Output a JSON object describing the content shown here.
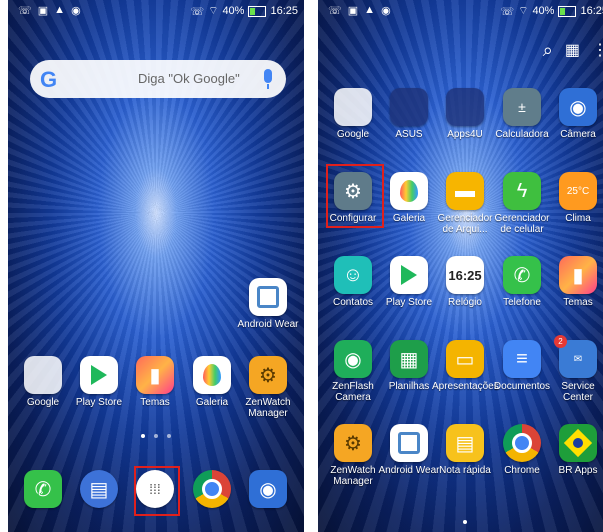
{
  "status": {
    "time": "16:25",
    "battery": "40%"
  },
  "left": {
    "search": {
      "placeholder": "Diga \"Ok Google\"",
      "logo": "G"
    },
    "widget_apps": [
      {
        "label": "Android Wear"
      }
    ],
    "row_apps": [
      {
        "label": "Google"
      },
      {
        "label": "Play Store"
      },
      {
        "label": "Temas"
      },
      {
        "label": "Galeria"
      },
      {
        "label": "ZenWatch Manager"
      }
    ],
    "dock": [
      {
        "name": "phone",
        "icon": "phone-icon"
      },
      {
        "name": "messages",
        "icon": "message-icon"
      },
      {
        "name": "app-drawer",
        "icon": "app-drawer-icon"
      },
      {
        "name": "chrome",
        "icon": "chrome-icon"
      },
      {
        "name": "camera",
        "icon": "camera-icon"
      }
    ]
  },
  "right": {
    "top_bar": {
      "search_icon": "search-icon",
      "menu_icon": "grid-settings-icon"
    },
    "apps": [
      {
        "label": "Google"
      },
      {
        "label": "ASUS"
      },
      {
        "label": "Apps4U"
      },
      {
        "label": "Calculadora"
      },
      {
        "label": "Câmera"
      },
      {
        "label": "Configurar"
      },
      {
        "label": "Galeria"
      },
      {
        "label": "Gerenciador de Arqui..."
      },
      {
        "label": "Gerenciador de celular"
      },
      {
        "label": "Clima"
      },
      {
        "label": "Contatos"
      },
      {
        "label": "Play Store"
      },
      {
        "label": "Relógio"
      },
      {
        "label": "Telefone"
      },
      {
        "label": "Temas"
      },
      {
        "label": "ZenFlash Camera"
      },
      {
        "label": "Planilhas"
      },
      {
        "label": "Apresentações"
      },
      {
        "label": "Documentos"
      },
      {
        "label": "Service Center"
      },
      {
        "label": "ZenWatch Manager"
      },
      {
        "label": "Android Wear"
      },
      {
        "label": "Nota rápida"
      },
      {
        "label": "Chrome"
      },
      {
        "label": "BR Apps"
      }
    ],
    "clock_icon_text": "16:25",
    "clima_icon_text": "25°C",
    "service_badge": "2"
  },
  "colors": {
    "highlight": "#e0201c",
    "accent": "#1a4fc4"
  }
}
